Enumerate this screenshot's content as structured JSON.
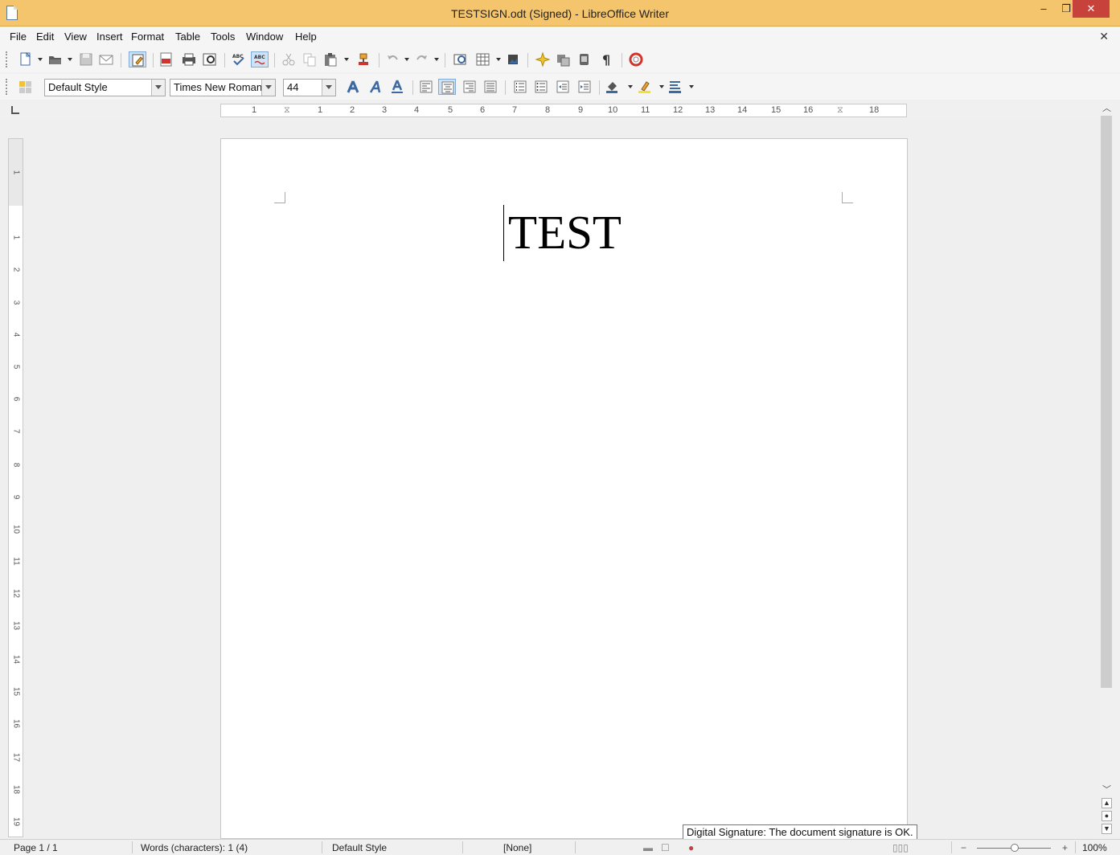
{
  "window": {
    "title": "TESTSIGN.odt (Signed) - LibreOffice Writer",
    "minimize": "–",
    "maximize": "❐",
    "close": "✕"
  },
  "menu": {
    "items": [
      "File",
      "Edit",
      "View",
      "Insert",
      "Format",
      "Table",
      "Tools",
      "Window",
      "Help"
    ],
    "close_document": "✕"
  },
  "format_toolbar": {
    "paragraph_style": "Default Style",
    "font_name": "Times New Roman",
    "font_size": "44"
  },
  "ruler": {
    "horizontal": [
      "1",
      "1",
      "2",
      "3",
      "4",
      "5",
      "6",
      "7",
      "8",
      "9",
      "10",
      "11",
      "12",
      "13",
      "14",
      "15",
      "16",
      "17",
      "18"
    ],
    "vertical": [
      "1",
      "1",
      "2",
      "3",
      "4",
      "5",
      "6",
      "7",
      "8",
      "9",
      "10",
      "11",
      "12",
      "13",
      "14",
      "15",
      "16",
      "17",
      "18",
      "19"
    ]
  },
  "document": {
    "text": "TEST"
  },
  "tooltip": {
    "text": "Digital Signature: The document signature is OK."
  },
  "statusbar": {
    "page": "Page 1 / 1",
    "words": "Words (characters): 1 (4)",
    "page_style": "Default Style",
    "language": "[None]",
    "zoom": "100%",
    "zoom_minus": "−",
    "zoom_plus": "+"
  },
  "colors": {
    "titlebar": "#f4c56d",
    "close_button": "#c7423a",
    "active_button": "#cfe3f7"
  }
}
